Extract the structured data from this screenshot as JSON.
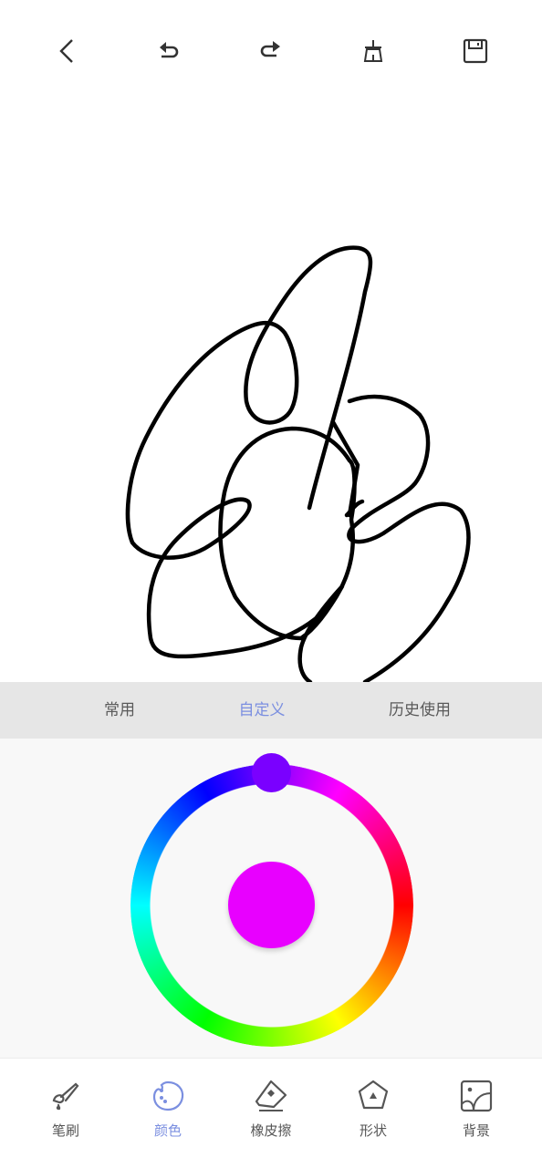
{
  "toolbar": {
    "buttons": [
      {
        "name": "back",
        "icon": "chevron-left-icon"
      },
      {
        "name": "undo",
        "icon": "undo-icon"
      },
      {
        "name": "redo",
        "icon": "redo-icon"
      },
      {
        "name": "clear",
        "icon": "broom-icon"
      },
      {
        "name": "save",
        "icon": "floppy-disk-icon"
      }
    ]
  },
  "canvas": {
    "stroke_color": "#000000"
  },
  "color_tabs": {
    "items": [
      "常用",
      "自定义",
      "历史使用"
    ],
    "active_index": 1
  },
  "color_picker": {
    "selected_hue_color": "#7a00ff",
    "current_color": "#e800ff"
  },
  "bottom_nav": {
    "items": [
      {
        "label": "笔刷",
        "icon": "paintbrush-icon"
      },
      {
        "label": "颜色",
        "icon": "palette-icon"
      },
      {
        "label": "橡皮擦",
        "icon": "eraser-icon"
      },
      {
        "label": "形状",
        "icon": "shape-pentagon-icon"
      },
      {
        "label": "背景",
        "icon": "background-image-icon"
      }
    ],
    "active_index": 1
  },
  "colors": {
    "accent": "#7b8fe0",
    "icon_gray": "#555555",
    "tab_bar_bg": "#e6e6e6",
    "picker_bg": "#f8f8f8"
  }
}
